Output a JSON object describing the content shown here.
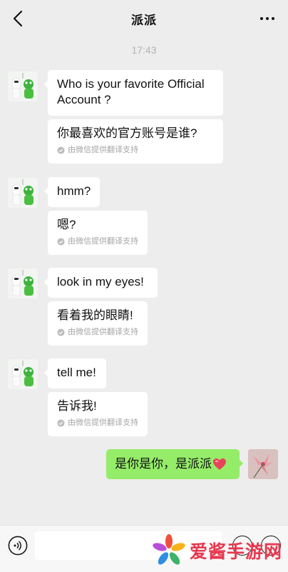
{
  "header": {
    "title": "派派"
  },
  "timestamp": "17:43",
  "messages": [
    {
      "text": "Who is your favorite Official Account ?",
      "translation": "你最喜欢的官方账号是谁?",
      "note": "由微信提供翻译支持"
    },
    {
      "text": "hmm?",
      "translation": "嗯?",
      "note": "由微信提供翻译支持"
    },
    {
      "text": "look in my eyes!",
      "translation": "看着我的眼睛!",
      "note": "由微信提供翻译支持"
    },
    {
      "text": "tell me!",
      "translation": "告诉我!",
      "note": "由微信提供翻译支持"
    }
  ],
  "sent_message": {
    "text": "是你是你，是派派"
  },
  "watermark": {
    "text": "爱酱手游网"
  },
  "colors": {
    "background": "#ededed",
    "sent_bubble": "#95ec69",
    "heart": "#e8435a",
    "watermark": "#e8384f"
  },
  "icons": {
    "back": "back-arrow-icon",
    "more": "more-dots-icon",
    "voice": "voice-icon",
    "check": "check-circle-icon",
    "heart": "heart-emoji-icon"
  }
}
